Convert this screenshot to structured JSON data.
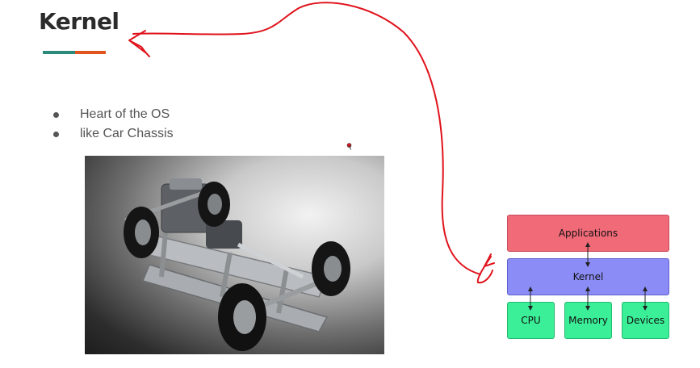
{
  "slide": {
    "title": "Kernel",
    "bullets": [
      "Heart of the OS",
      "like Car Chassis"
    ],
    "accent_colors": {
      "teal": "#2b8a7a",
      "orange": "#e0551f"
    }
  },
  "diagram": {
    "applications": "Applications",
    "kernel": "Kernel",
    "cpu": "CPU",
    "memory": "Memory",
    "devices": "Devices",
    "colors": {
      "applications": "#f06a78",
      "kernel": "#8b8cf6",
      "hardware": "#3bef98",
      "annotation_ink": "#e0131c"
    }
  },
  "image": {
    "subject": "car chassis photo"
  }
}
